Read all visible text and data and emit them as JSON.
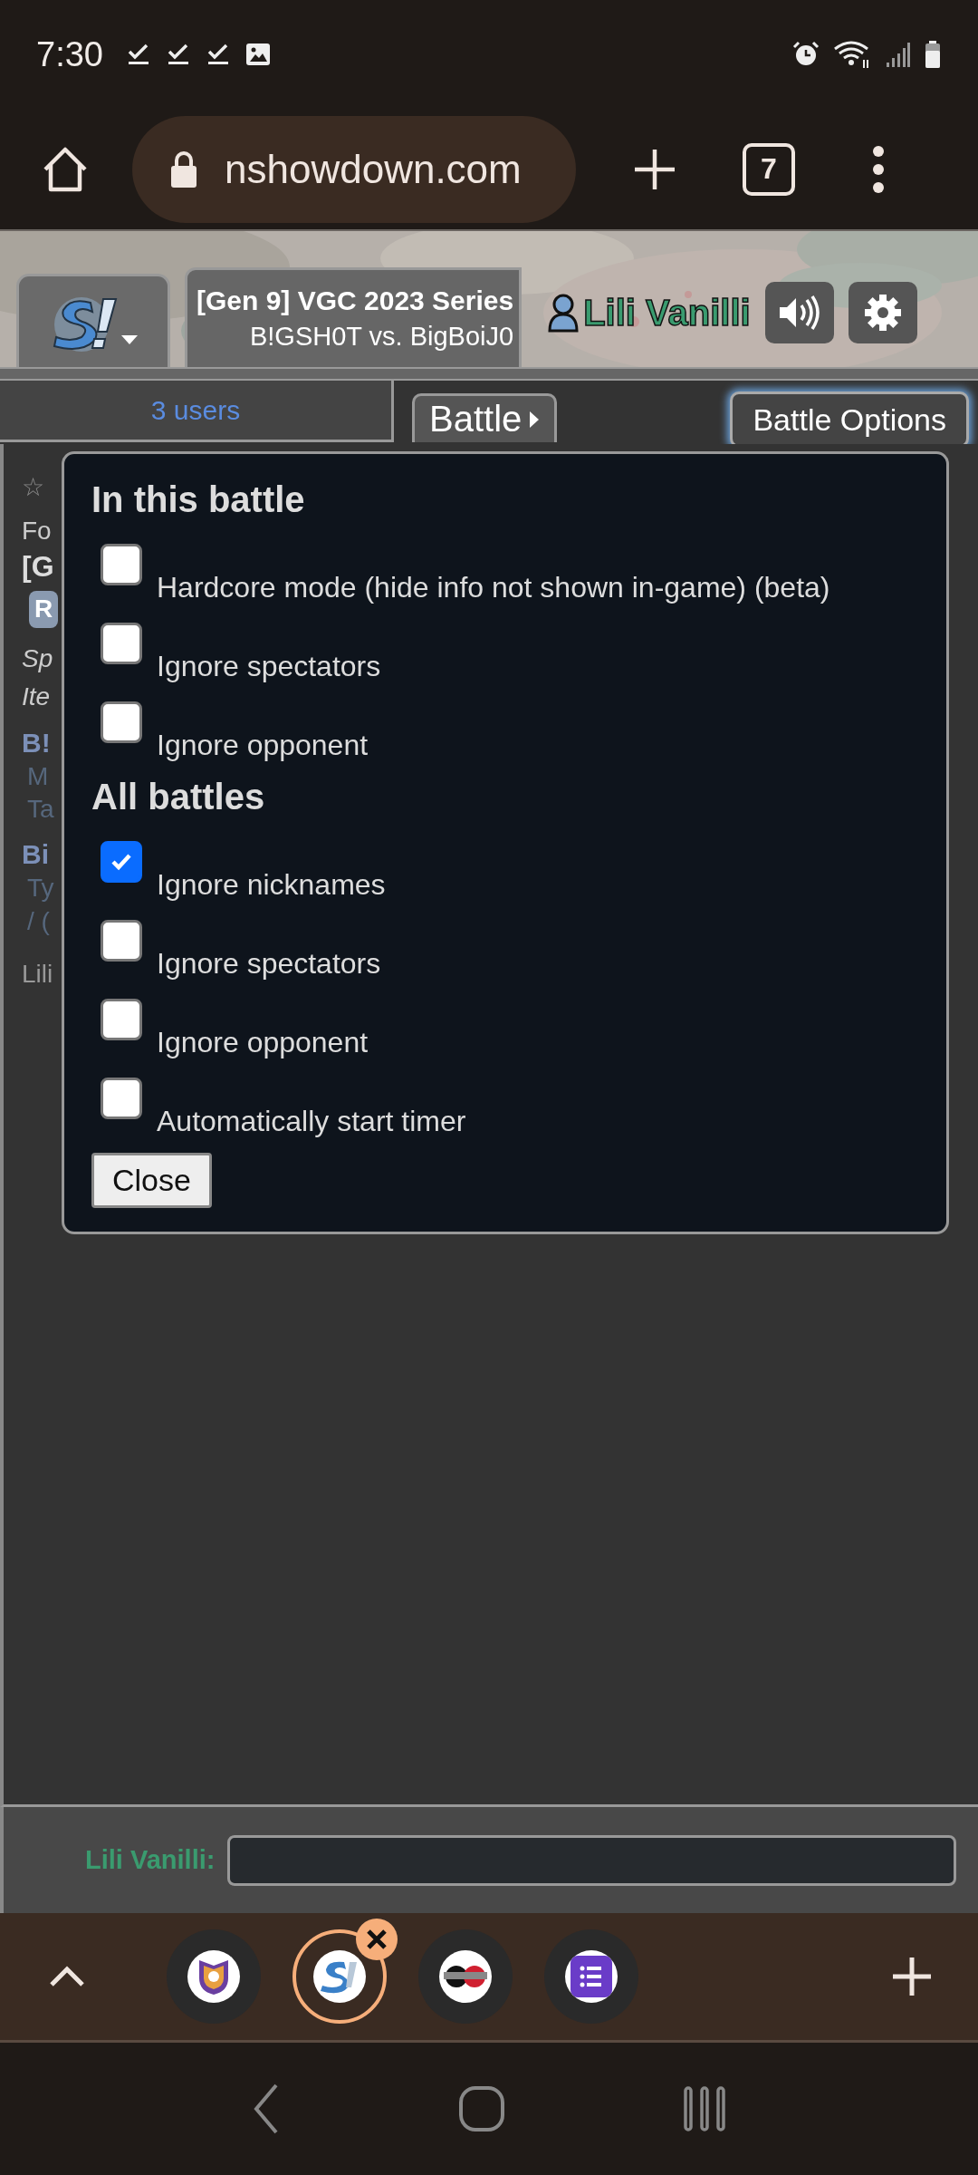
{
  "status_bar": {
    "time": "7:30"
  },
  "browser": {
    "url": "nshowdown.com",
    "tab_count": "7"
  },
  "header": {
    "title": "[Gen 9] VGC 2023 Series",
    "subtitle": "B!GSH0T vs. BigBoiJ0",
    "username": "Lili Vanilli"
  },
  "room_bar": {
    "users": "3 users",
    "battle_button": "Battle",
    "options_button": "Battle Options"
  },
  "log_fragments": [
    {
      "kind": "faint",
      "text": "☆"
    },
    {
      "kind": "plain",
      "text": "Fo"
    },
    {
      "kind": "bold",
      "text": "[G"
    },
    {
      "kind": "badge",
      "text": "R"
    },
    {
      "kind": "italic",
      "text": "Sp"
    },
    {
      "kind": "italic",
      "text": "Ite"
    },
    {
      "kind": "player",
      "text": "B!"
    },
    {
      "kind": "detail",
      "text": "M"
    },
    {
      "kind": "detail",
      "text": "Ta"
    },
    {
      "kind": "player",
      "text": "Bi"
    },
    {
      "kind": "detail",
      "text": "Ty"
    },
    {
      "kind": "detail",
      "text": "/ ("
    },
    {
      "kind": "muted",
      "text": "Lili"
    }
  ],
  "dialog": {
    "sections": [
      {
        "title": "In this battle",
        "options": [
          {
            "label": "Hardcore mode (hide info not shown in-game) (beta)",
            "checked": false
          },
          {
            "label": "Ignore spectators",
            "checked": false
          },
          {
            "label": "Ignore opponent",
            "checked": false
          }
        ]
      },
      {
        "title": "All battles",
        "options": [
          {
            "label": "Ignore nicknames",
            "checked": true
          },
          {
            "label": "Ignore spectators",
            "checked": false
          },
          {
            "label": "Ignore opponent",
            "checked": false
          },
          {
            "label": "Automatically start timer",
            "checked": false
          }
        ]
      }
    ],
    "close_button": "Close"
  },
  "chat": {
    "label": "Lili Vanilli:"
  },
  "browser_tabs": [
    {
      "kind": "crest",
      "selected": false
    },
    {
      "kind": "logo",
      "selected": true
    },
    {
      "kind": "badge",
      "selected": false
    },
    {
      "kind": "list",
      "selected": false
    }
  ]
}
